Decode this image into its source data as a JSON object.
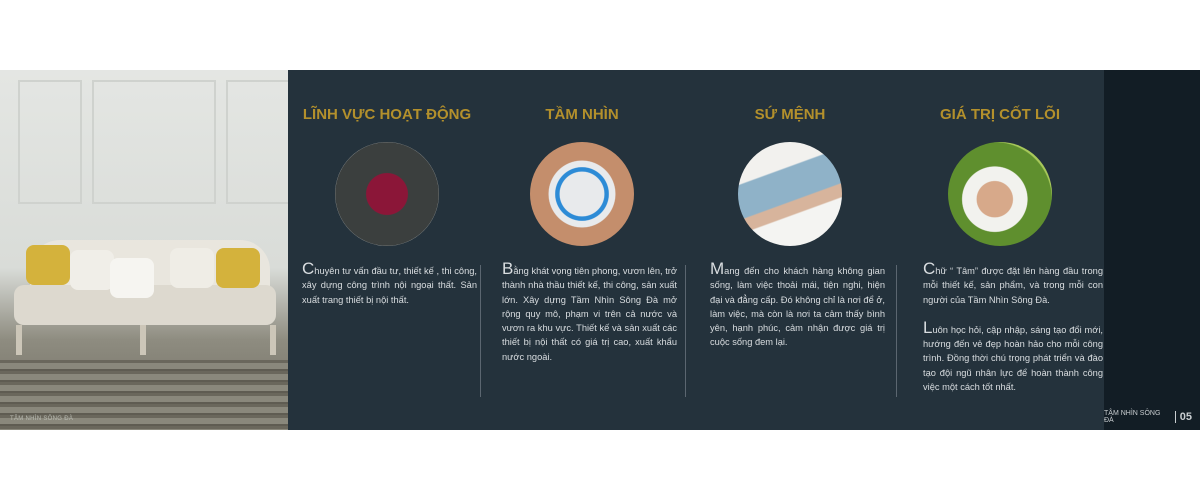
{
  "brand_watermark_left": "TÂM NHÌN SÔNG ĐÀ",
  "footer": {
    "brand": "TÂM NHÌN SÔNG ĐÀ",
    "page": "05"
  },
  "colors": {
    "background": "#24323c",
    "title": "#b3902c",
    "text": "#d9dde0",
    "strip": "#121d25"
  },
  "columns": [
    {
      "title": "LĨNH VỰC HOẠT ĐỘNG",
      "image": "red-armchair",
      "paragraphs": [
        {
          "drop": "C",
          "text": "huyên tư vấn đầu tư, thiết kế , thi công, xây dựng công trình nội ngoại thất. Sản xuất trang thiết bị nội thất."
        }
      ]
    },
    {
      "title": "TẦM NHÌN",
      "image": "hands-circle-logo",
      "paragraphs": [
        {
          "drop": "B",
          "text": "ằng khát vọng tiên phong, vươn lên, trở thành nhà thầu thiết kế, thi công, sản xuất lớn. Xây dựng Tầm Nhìn Sông Đà mở rộng quy mô, phạm vi trên cả nước và vươn ra khu vực. Thiết kế và sản xuất các thiết bị nội thất có giá trị cao, xuất khẩu nước ngoài."
        }
      ]
    },
    {
      "title": "SỨ MỆNH",
      "image": "couple-relaxing",
      "paragraphs": [
        {
          "drop": "M",
          "text": "ang đến cho khách hàng không gian sống, làm việc thoải mái, tiện nghi, hiện đại và đẳng cấp. Đó không chỉ là nơi để ở, làm việc, mà còn là nơi ta cảm thấy bình yên, hạnh phúc, cảm nhận được giá trị cuộc sống đem lại."
        }
      ]
    },
    {
      "title": "GIÁ TRỊ CỐT LÕI",
      "image": "meditation",
      "paragraphs": [
        {
          "drop": "C",
          "text": "hữ “ Tâm” được đặt lên hàng đầu trong mỗi thiết kế, sản phẩm, và trong mỗi con người của Tầm Nhìn Sông Đà."
        },
        {
          "drop": "L",
          "text": "uôn học hỏi, cập nhập, sáng tạo đổi mới, hướng đến vẻ đẹp hoàn hảo cho mỗi công trình. Đồng thời chú trọng phát triển và đào tạo đội ngũ nhân lực để hoàn thành công việc một cách tốt nhất."
        }
      ]
    }
  ]
}
